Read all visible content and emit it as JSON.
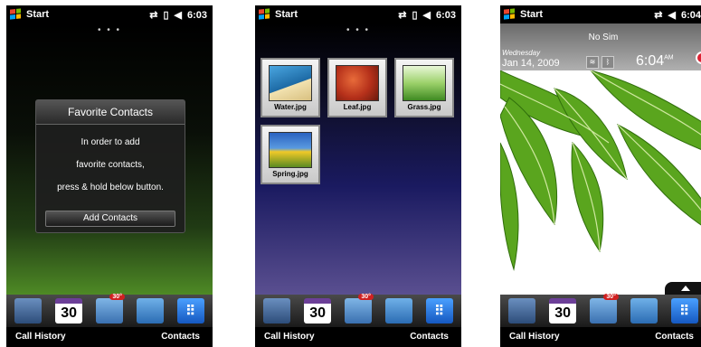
{
  "status": {
    "start_label": "Start",
    "time_1": "6:03",
    "time_2": "6:03",
    "time_3": "6:04"
  },
  "dots": "• • •",
  "softkeys": {
    "left": "Call History",
    "right": "Contacts"
  },
  "dock": {
    "calendar_day": "30",
    "weather_badge": "30°"
  },
  "favorite_contacts": {
    "title": "Favorite Contacts",
    "line1": "In order to add",
    "line2": "favorite contacts,",
    "line3": "press & hold below button.",
    "button": "Add Contacts"
  },
  "photos": [
    {
      "caption": "Water.jpg"
    },
    {
      "caption": "Leaf.jpg"
    },
    {
      "caption": "Grass.jpg"
    },
    {
      "caption": "Spring.jpg"
    }
  ],
  "home": {
    "no_sim": "No Sim",
    "weekday": "Wednesday",
    "date": "Jan 14, 2009",
    "time": "6:04",
    "ampm": "AM"
  },
  "colors": {
    "windows_red": "#e8452c",
    "windows_green": "#7cbb00",
    "windows_blue": "#00a1f1",
    "windows_yellow": "#ffbb00"
  }
}
